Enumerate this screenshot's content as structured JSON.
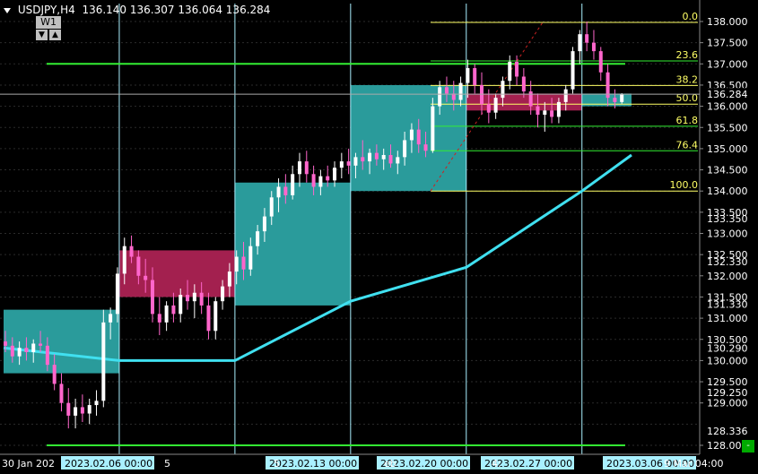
{
  "header": {
    "symbol": "USDJPY,H4",
    "open": "136.140",
    "high": "136.307",
    "low": "136.064",
    "close": "136.284"
  },
  "timeframe": {
    "label": "W1",
    "down": "▼",
    "up": "▲"
  },
  "colors": {
    "background": "#000000",
    "bull": "#ffffff",
    "bear": "#ff66cc",
    "ma": "#40e0f0",
    "fib": "#ffff66",
    "level": "#33ee33",
    "box_teal": "#2a9b9b",
    "box_pink": "#a3204f",
    "separator": "#a9f0ff",
    "axis_text": "#ffffff",
    "grid": "#2b2b2b"
  },
  "price_axis": {
    "ticks": [
      "138.000",
      "137.500",
      "137.000",
      "136.500",
      "136.000",
      "135.500",
      "135.000",
      "134.500",
      "134.000",
      "133.500",
      "133.000",
      "132.500",
      "132.000",
      "131.500",
      "131.000",
      "130.500",
      "130.000",
      "129.500",
      "129.000",
      "128.000"
    ],
    "overlap_labels": [
      "133.350",
      "132.330",
      "131.330",
      "130.290",
      "129.250"
    ],
    "current": "136.284",
    "marker": "128.336"
  },
  "time_axis": {
    "labels": [
      "30 Jan 202",
      "2023.02.06 00:00",
      "5",
      "2023.02.13 00:00",
      "5",
      "2023.02.20 00:00",
      "eb",
      "2023.02.27 00:00",
      "4:",
      "2023.03.06 00:00",
      "9 Mar 04:00"
    ],
    "highlight": [
      "2023.02.06 00:00",
      "2023.02.13 00:00",
      "2023.02.20 00:00",
      "2023.02.27 00:00",
      "2023.03.06 00:00"
    ]
  },
  "fib_levels": [
    {
      "label": "0.0",
      "price": 137.98
    },
    {
      "label": "23.6",
      "price": 137.07
    },
    {
      "label": "38.2",
      "price": 136.49
    },
    {
      "label": "50.0",
      "price": 136.05
    },
    {
      "label": "61.8",
      "price": 135.53
    },
    {
      "label": "76.4",
      "price": 134.95
    },
    {
      "label": "100.0",
      "price": 134.0
    }
  ],
  "mini_button": "-",
  "chart_data": {
    "type": "candlestick",
    "symbol": "USDJPY",
    "timeframe": "H4",
    "ylim": [
      127.9,
      138.4
    ],
    "xlim": [
      "2023-01-30",
      "2023-03-09"
    ],
    "candles_ohlc": [
      [
        130.45,
        130.7,
        130.2,
        130.35
      ],
      [
        130.35,
        130.55,
        129.95,
        130.1
      ],
      [
        130.1,
        130.45,
        129.9,
        130.3
      ],
      [
        130.3,
        130.55,
        130.0,
        130.2
      ],
      [
        130.2,
        130.5,
        129.95,
        130.4
      ],
      [
        130.4,
        130.7,
        130.2,
        130.35
      ],
      [
        130.35,
        130.55,
        129.75,
        129.9
      ],
      [
        129.9,
        130.15,
        129.3,
        129.45
      ],
      [
        129.45,
        129.7,
        128.8,
        129.0
      ],
      [
        129.0,
        129.35,
        128.4,
        128.7
      ],
      [
        128.7,
        129.1,
        128.4,
        128.9
      ],
      [
        128.9,
        129.2,
        128.55,
        128.75
      ],
      [
        128.75,
        129.1,
        128.5,
        128.95
      ],
      [
        128.95,
        129.3,
        128.7,
        129.05
      ],
      [
        129.05,
        131.2,
        128.9,
        130.9
      ],
      [
        130.9,
        131.25,
        130.5,
        131.1
      ],
      [
        131.1,
        132.2,
        130.9,
        132.05
      ],
      [
        132.05,
        132.9,
        131.8,
        132.7
      ],
      [
        132.7,
        132.95,
        132.3,
        132.45
      ],
      [
        132.45,
        132.6,
        131.8,
        132.0
      ],
      [
        132.0,
        132.4,
        131.6,
        131.9
      ],
      [
        131.9,
        132.2,
        130.9,
        131.1
      ],
      [
        131.1,
        131.5,
        130.6,
        130.9
      ],
      [
        130.9,
        131.4,
        130.7,
        131.3
      ],
      [
        131.3,
        131.6,
        130.9,
        131.1
      ],
      [
        131.1,
        131.7,
        130.9,
        131.55
      ],
      [
        131.55,
        131.9,
        131.2,
        131.4
      ],
      [
        131.4,
        131.8,
        131.0,
        131.6
      ],
      [
        131.6,
        131.85,
        131.1,
        131.3
      ],
      [
        131.3,
        131.6,
        130.5,
        130.7
      ],
      [
        130.7,
        131.5,
        130.5,
        131.4
      ],
      [
        131.4,
        131.9,
        131.2,
        131.75
      ],
      [
        131.75,
        132.3,
        131.5,
        132.1
      ],
      [
        132.1,
        132.6,
        131.8,
        132.45
      ],
      [
        132.45,
        132.8,
        131.9,
        132.15
      ],
      [
        132.15,
        132.9,
        132.0,
        132.7
      ],
      [
        132.7,
        133.2,
        132.5,
        133.05
      ],
      [
        133.05,
        133.6,
        132.8,
        133.4
      ],
      [
        133.4,
        134.0,
        133.2,
        133.85
      ],
      [
        133.85,
        134.3,
        133.5,
        134.1
      ],
      [
        134.1,
        134.4,
        133.7,
        133.9
      ],
      [
        133.9,
        134.6,
        133.8,
        134.4
      ],
      [
        134.4,
        134.9,
        134.1,
        134.7
      ],
      [
        134.7,
        134.95,
        134.2,
        134.4
      ],
      [
        134.4,
        134.6,
        133.9,
        134.1
      ],
      [
        134.1,
        134.5,
        133.9,
        134.35
      ],
      [
        134.35,
        134.6,
        134.1,
        134.25
      ],
      [
        134.25,
        134.7,
        134.1,
        134.55
      ],
      [
        134.55,
        134.9,
        134.3,
        134.7
      ],
      [
        134.7,
        135.0,
        134.4,
        134.6
      ],
      [
        134.6,
        134.9,
        134.3,
        134.8
      ],
      [
        134.8,
        135.2,
        134.5,
        134.7
      ],
      [
        134.7,
        135.0,
        134.4,
        134.9
      ],
      [
        134.9,
        135.1,
        134.6,
        134.75
      ],
      [
        134.75,
        135.0,
        134.5,
        134.85
      ],
      [
        134.85,
        135.1,
        134.55,
        134.65
      ],
      [
        134.65,
        134.95,
        134.4,
        134.8
      ],
      [
        134.8,
        135.4,
        134.6,
        135.2
      ],
      [
        135.2,
        135.6,
        134.9,
        135.45
      ],
      [
        135.45,
        135.7,
        134.9,
        135.1
      ],
      [
        135.1,
        135.4,
        134.8,
        134.95
      ],
      [
        134.95,
        136.2,
        134.9,
        136.0
      ],
      [
        136.0,
        136.6,
        135.8,
        136.45
      ],
      [
        136.45,
        136.7,
        136.1,
        136.3
      ],
      [
        136.3,
        136.6,
        135.9,
        136.15
      ],
      [
        136.15,
        136.7,
        136.0,
        136.55
      ],
      [
        136.55,
        137.1,
        136.2,
        136.9
      ],
      [
        136.9,
        137.0,
        136.3,
        136.5
      ],
      [
        136.5,
        136.8,
        135.8,
        136.05
      ],
      [
        136.05,
        136.4,
        135.6,
        135.85
      ],
      [
        135.85,
        136.3,
        135.7,
        136.2
      ],
      [
        136.2,
        136.7,
        136.0,
        136.6
      ],
      [
        136.6,
        137.2,
        136.4,
        137.05
      ],
      [
        137.05,
        137.2,
        136.5,
        136.7
      ],
      [
        136.7,
        136.9,
        136.2,
        136.35
      ],
      [
        136.35,
        136.6,
        135.8,
        136.0
      ],
      [
        136.0,
        136.3,
        135.5,
        135.8
      ],
      [
        135.8,
        136.1,
        135.4,
        135.9
      ],
      [
        135.9,
        136.2,
        135.6,
        135.75
      ],
      [
        135.75,
        136.2,
        135.6,
        136.1
      ],
      [
        136.1,
        136.5,
        135.9,
        136.4
      ],
      [
        136.4,
        137.4,
        136.3,
        137.3
      ],
      [
        137.3,
        137.8,
        137.0,
        137.7
      ],
      [
        137.7,
        138.0,
        137.3,
        137.5
      ],
      [
        137.5,
        137.8,
        137.1,
        137.3
      ],
      [
        137.3,
        137.4,
        136.6,
        136.8
      ],
      [
        136.8,
        137.0,
        136.0,
        136.2
      ],
      [
        136.2,
        136.4,
        135.95,
        136.1
      ],
      [
        136.1,
        136.31,
        136.06,
        136.28
      ]
    ],
    "ma_line": [
      [
        "2023-01-30",
        130.3
      ],
      [
        "2023-02-06",
        130.0
      ],
      [
        "2023-02-13",
        130.0
      ],
      [
        "2023-02-20",
        131.4
      ],
      [
        "2023-02-27",
        132.2
      ],
      [
        "2023-03-06",
        134.0
      ],
      [
        "2023-03-09",
        134.85
      ]
    ],
    "horizontal_levels": [
      137.0,
      128.0
    ],
    "zones": [
      {
        "kind": "demand",
        "from": "2023-01-30",
        "to": "2023-02-06",
        "low": 129.7,
        "high": 131.2
      },
      {
        "kind": "supply",
        "from": "2023-02-06",
        "to": "2023-02-13",
        "low": 131.5,
        "high": 132.6
      },
      {
        "kind": "demand",
        "from": "2023-02-13",
        "to": "2023-02-20",
        "low": 131.3,
        "high": 134.2
      },
      {
        "kind": "demand",
        "from": "2023-02-20",
        "to": "2023-02-27",
        "low": 134.0,
        "high": 136.5
      },
      {
        "kind": "supply",
        "from": "2023-02-27",
        "to": "2023-03-06",
        "low": 135.9,
        "high": 136.3
      },
      {
        "kind": "demand",
        "from": "2023-03-06",
        "to": "2023-03-09",
        "low": 136.0,
        "high": 136.3
      }
    ]
  }
}
